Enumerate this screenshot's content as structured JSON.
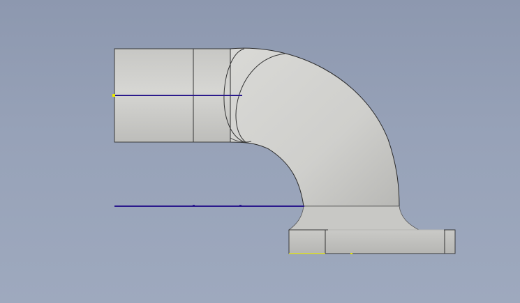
{
  "viewport": {
    "background_top": "#8d98af",
    "background_bottom": "#9ea9be"
  },
  "model": {
    "name": "pipe-elbow-with-flange",
    "body_color": "#d0d0ce",
    "shade_color": "#b9b9b6",
    "edge_color": "#2a2a2a"
  },
  "sketch": {
    "line_color": "#2b1a8c",
    "point_color": "#e8e800"
  }
}
